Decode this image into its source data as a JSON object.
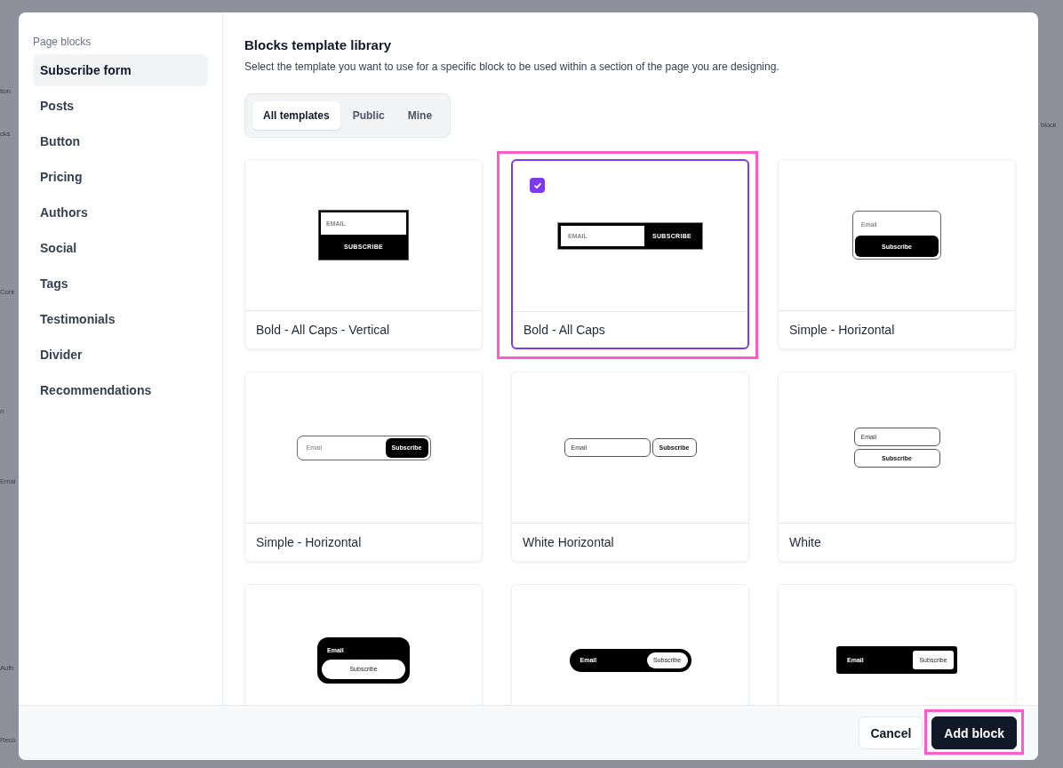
{
  "background": {
    "left_fragments": [
      {
        "text": "tion"
      },
      {
        "text": "cks"
      },
      {
        "text": "Cont"
      },
      {
        "text": "n"
      },
      {
        "text": "Emai"
      },
      {
        "text": "Auth"
      },
      {
        "text": "Reco"
      }
    ],
    "right_fragments": [
      {
        "text": "block"
      }
    ]
  },
  "sidebar": {
    "heading": "Page blocks",
    "items": [
      {
        "label": "Subscribe form",
        "selected": true
      },
      {
        "label": "Posts",
        "selected": false
      },
      {
        "label": "Button",
        "selected": false
      },
      {
        "label": "Pricing",
        "selected": false
      },
      {
        "label": "Authors",
        "selected": false
      },
      {
        "label": "Social",
        "selected": false
      },
      {
        "label": "Tags",
        "selected": false
      },
      {
        "label": "Testimonials",
        "selected": false
      },
      {
        "label": "Divider",
        "selected": false
      },
      {
        "label": "Recommendations",
        "selected": false
      }
    ]
  },
  "library": {
    "title": "Blocks template library",
    "description": "Select the template you want to use for a specific block to be used within a section of the page you are designing.",
    "tabs": [
      {
        "label": "All templates",
        "selected": true
      },
      {
        "label": "Public",
        "selected": false
      },
      {
        "label": "Mine",
        "selected": false
      }
    ],
    "cards": [
      {
        "kind": "bold-vertical",
        "email": "EMAIL",
        "button": "SUBSCRIBE",
        "label": "Bold - All Caps - Vertical",
        "selected": false,
        "highlighted": false
      },
      {
        "kind": "bold-horizontal",
        "email": "EMAIL",
        "button": "SUBSCRIBE",
        "label": "Bold - All Caps",
        "selected": true,
        "highlighted": true
      },
      {
        "kind": "simple-stacked",
        "email": "Email",
        "button": "Subscribe",
        "label": "Simple - Horizontal",
        "selected": false,
        "highlighted": false
      },
      {
        "kind": "simple-horizontal",
        "email": "Email",
        "button": "Subscribe",
        "label": "Simple - Horizontal",
        "selected": false,
        "highlighted": false
      },
      {
        "kind": "white-horizontal",
        "email": "Email",
        "button": "Subscribe",
        "label": "White Horizontal",
        "selected": false,
        "highlighted": false
      },
      {
        "kind": "white-stacked",
        "email": "Email",
        "button": "Subscribe",
        "label": "White",
        "selected": false,
        "highlighted": false
      },
      {
        "kind": "black-stacked",
        "email": "Email",
        "button": "Subscribe",
        "selected": false,
        "highlighted": false
      },
      {
        "kind": "black-pill",
        "email": "Email",
        "button": "Subscribe",
        "selected": false,
        "highlighted": false
      },
      {
        "kind": "black-rect",
        "email": "Email",
        "button": "Subscribe",
        "selected": false,
        "highlighted": false
      }
    ]
  },
  "footer": {
    "buttons": [
      {
        "label": "Cancel",
        "kind": "secondary",
        "highlighted": false
      },
      {
        "label": "Add block",
        "kind": "primary",
        "highlighted": true
      }
    ]
  }
}
